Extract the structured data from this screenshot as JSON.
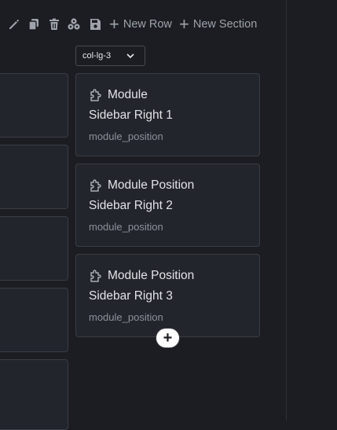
{
  "toolbar": {
    "icons": [
      "pencil-icon",
      "copy-icon",
      "trash-icon",
      "cubes-icon",
      "save-icon"
    ],
    "new_row_label": "New Row",
    "new_section_label": "New Section"
  },
  "column_select": {
    "value": "col-lg-3"
  },
  "modules": [
    {
      "title": "Module",
      "position_name": "Sidebar Right 1",
      "position_key": "module_position"
    },
    {
      "title": "Module Position",
      "position_name": "Sidebar Right 2",
      "position_key": "module_position"
    },
    {
      "title": "Module Position",
      "position_name": "Sidebar Right 3",
      "position_key": "module_position"
    }
  ],
  "add_module_label": "+",
  "colors": {
    "background": "#1b1d22",
    "card": "#23252c",
    "border": "#3a3d45",
    "text": "#e2e4e8",
    "muted": "#8c9199"
  }
}
